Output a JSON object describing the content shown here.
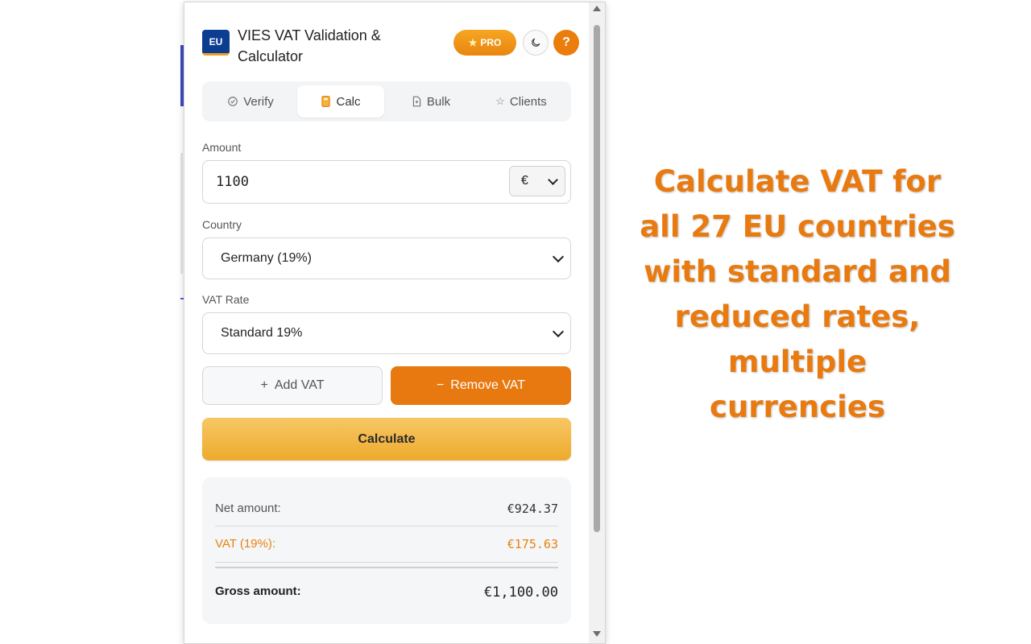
{
  "header": {
    "logo_text": "EU",
    "title": "VIES VAT Validation & Calculator",
    "pro_label": "PRO",
    "help_label": "?"
  },
  "tabs": [
    {
      "label": "Verify",
      "icon": "check-circle-icon"
    },
    {
      "label": "Calc",
      "icon": "calculator-icon",
      "active": true
    },
    {
      "label": "Bulk",
      "icon": "file-icon"
    },
    {
      "label": "Clients",
      "icon": "star-icon"
    }
  ],
  "form": {
    "amount_label": "Amount",
    "amount_value": "1100",
    "currency_value": "€",
    "country_label": "Country",
    "country_value": "Germany (19%)",
    "rate_label": "VAT Rate",
    "rate_value": "Standard 19%"
  },
  "actions": {
    "add_vat": "Add VAT",
    "remove_vat": "Remove VAT",
    "calculate": "Calculate"
  },
  "results": {
    "net_label": "Net amount:",
    "net_value": "€924.37",
    "vat_label": "VAT (19%):",
    "vat_value": "€175.63",
    "gross_label": "Gross amount:",
    "gross_value": "€1,100.00"
  },
  "caption": "Calculate VAT for all 27 EU countries with standard and reduced rates, multiple currencies",
  "colors": {
    "accent": "#e87910",
    "brand_blue": "#0b3d91",
    "calculate_gradient": "#f0b03a"
  }
}
